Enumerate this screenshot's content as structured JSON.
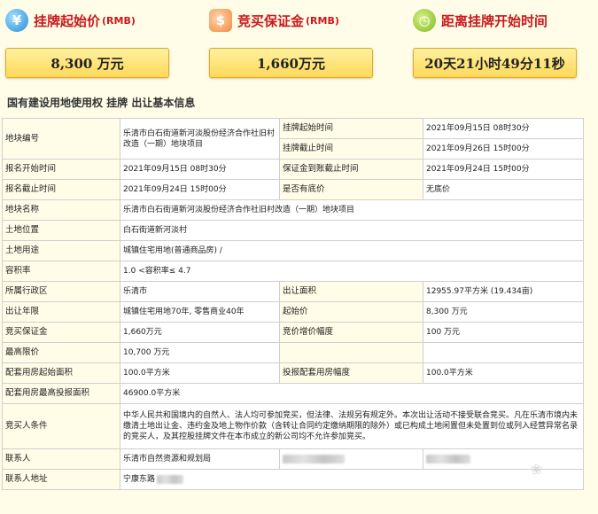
{
  "header": {
    "price": {
      "label": "挂牌起始价",
      "unit": "(RMB)",
      "value": "8,300 万元",
      "icon": "yuan-coin-icon"
    },
    "deposit": {
      "label": "竞买保证金",
      "unit": "(RMB)",
      "value": "1,660万元",
      "icon": "money-bag-icon"
    },
    "countdown": {
      "label": "距离挂牌开始时间",
      "value": "20天21小时49分11秒",
      "icon": "alarm-clock-icon"
    }
  },
  "section_title": "国有建设用地使用权  挂牌  出让基本信息",
  "table": {
    "plot_no_label": "地块编号",
    "plot_no_value": "乐清市白石街道新河淡股份经济合作社旧村改造（一期）地块项目",
    "listing_start_label": "挂牌起始时间",
    "listing_start_value": "2021年09月15日  08时30分",
    "listing_end_label": "挂牌截止时间",
    "listing_end_value": "2021年09月26日  15时00分",
    "signup_start_label": "报名开始时间",
    "signup_start_value": "2021年09月15日  08时30分",
    "deposit_deadline_label": "保证金到账截止时间",
    "deposit_deadline_value": "2021年09月24日  15时00分",
    "signup_end_label": "报名截止时间",
    "signup_end_value": "2021年09月24日  15时00分",
    "reserve_label": "是否有底价",
    "reserve_value": "无底价",
    "plot_name_label": "地块名称",
    "plot_name_value": "乐清市白石街道新河淡股份经济合作社旧村改造（一期）地块项目",
    "location_label": "土地位置",
    "location_value": "白石街道新河淡村",
    "use_label": "土地用途",
    "use_value": "城镇住宅用地(普通商品房) /",
    "far_label": "容积率",
    "far_value": "1.0 <容积率≤ 4.7",
    "district_label": "所属行政区",
    "district_value": "乐清市",
    "area_label": "出让面积",
    "area_value": "12955.97平方米 (19.434亩)",
    "term_label": "出让年限",
    "term_value": "城镇住宅用地70年, 零售商业40年",
    "start_price_label": "起始价",
    "start_price_value": "8,300 万元",
    "bid_deposit_label": "竞买保证金",
    "bid_deposit_value": "1,660万元",
    "increment_label": "竞价增价幅度",
    "increment_value": "100 万元",
    "max_price_label": "最高限价",
    "max_price_value": "10,700 万元",
    "housing_start_area_label": "配套用房起始面积",
    "housing_start_area_value": "100.0平方米",
    "housing_increment_label": "投报配套用房幅度",
    "housing_increment_value": "100.0平方米",
    "housing_max_area_label": "配套用房最高投报面积",
    "housing_max_area_value": "46900.0平方米",
    "conditions_label": "竞买人条件",
    "conditions_value": "中华人民共和国境内的自然人、法人均可参加竞买，但法律、法规另有规定外。本次出让活动不接受联合竞买。凡在乐清市境内未缴清土地出让金、违约金及地上物作价款（含转让合同约定缴纳期限的除外）或已构成土地闲置但未处置到位或列入经营异常名录的竞买人，及其控股挂牌文件在本市成立的新公司均不允许参加竞买。",
    "contact_label": "联系人",
    "contact_value": "乐清市自然资源和规划局",
    "address_label": "联系人地址",
    "address_value": "宁康东路"
  }
}
